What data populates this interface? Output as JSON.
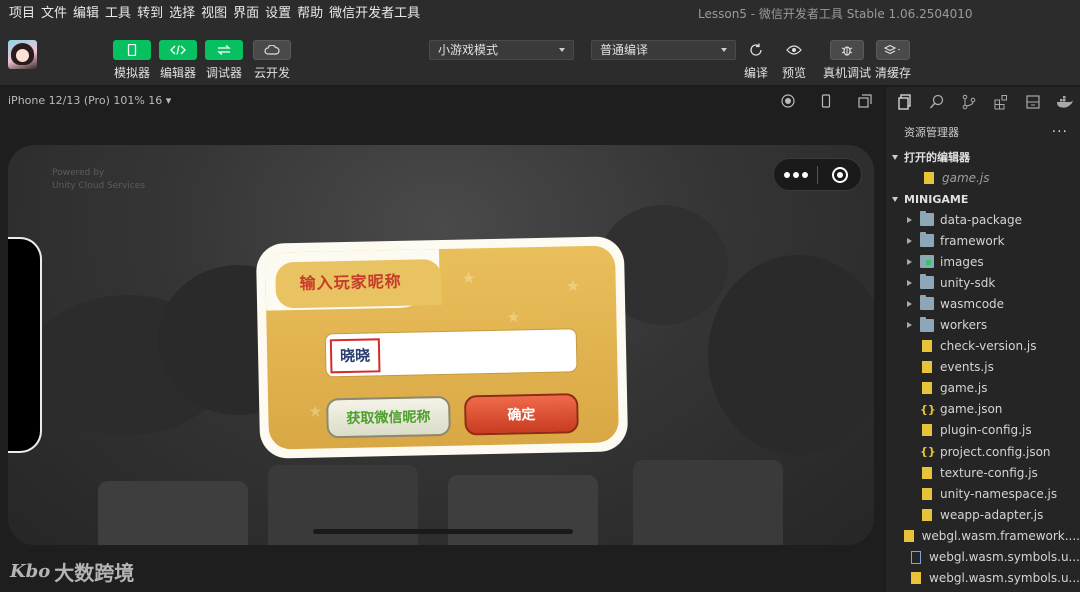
{
  "menu": [
    "项目",
    "文件",
    "编辑",
    "工具",
    "转到",
    "选择",
    "视图",
    "界面",
    "设置",
    "帮助",
    "微信开发者工具"
  ],
  "window_title": "Lesson5 - 微信开发者工具 Stable 1.06.2504010",
  "toolbar": {
    "simulator": "模拟器",
    "editor": "编辑器",
    "debugger": "调试器",
    "cloud": "云开发",
    "mode_select": "小游戏模式",
    "compile_select": "普通编译",
    "compile": "编译",
    "preview": "预览",
    "real_debug": "真机调试",
    "clear_cache": "清缓存"
  },
  "simulator": {
    "device": "iPhone 12/13 (Pro) 101% 16 ▾",
    "unity_text": "Powered by\nUnity Cloud Services"
  },
  "dialog": {
    "title": "输入玩家昵称",
    "nickname": "晓晓",
    "wechat_button": "获取微信昵称",
    "confirm_button": "确定"
  },
  "watermark": {
    "mark": "Kbo",
    "text": "大数跨境"
  },
  "explorer": {
    "title": "资源管理器",
    "more": "···",
    "open_editors": "打开的编辑器",
    "open_file": "game.js",
    "project": "MINIGAME",
    "items": [
      {
        "name": "data-package",
        "type": "folder"
      },
      {
        "name": "framework",
        "type": "folder"
      },
      {
        "name": "images",
        "type": "folder-img"
      },
      {
        "name": "unity-sdk",
        "type": "folder"
      },
      {
        "name": "wasmcode",
        "type": "folder"
      },
      {
        "name": "workers",
        "type": "folder"
      },
      {
        "name": "check-version.js",
        "type": "js"
      },
      {
        "name": "events.js",
        "type": "js"
      },
      {
        "name": "game.js",
        "type": "js"
      },
      {
        "name": "game.json",
        "type": "json"
      },
      {
        "name": "plugin-config.js",
        "type": "js"
      },
      {
        "name": "project.config.json",
        "type": "json"
      },
      {
        "name": "texture-config.js",
        "type": "js"
      },
      {
        "name": "unity-namespace.js",
        "type": "js"
      },
      {
        "name": "weapp-adapter.js",
        "type": "js"
      },
      {
        "name": "webgl.wasm.framework....",
        "type": "js"
      },
      {
        "name": "webgl.wasm.symbols.u...",
        "type": "doc"
      },
      {
        "name": "webgl.wasm.symbols.u...",
        "type": "bin"
      }
    ]
  },
  "colors": {
    "accent": "#07c160",
    "title_red": "#c63d2a",
    "panel": "#252526"
  }
}
